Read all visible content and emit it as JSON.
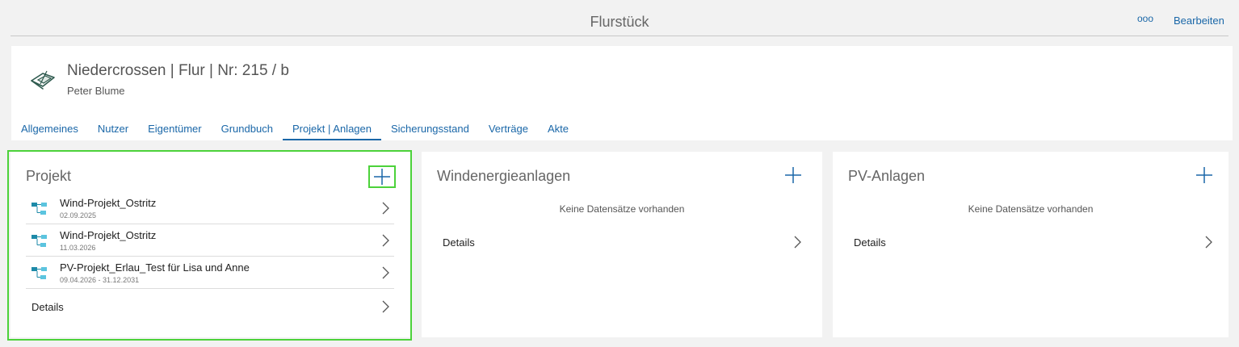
{
  "topbar": {
    "title": "Flurstück",
    "more_icon": "ooo",
    "edit_label": "Bearbeiten"
  },
  "header": {
    "title": "Niedercrossen | Flur | Nr: 215 / b",
    "subtitle": "Peter Blume",
    "icon": "parcel-icon"
  },
  "tabs": [
    {
      "label": "Allgemeines",
      "active": false
    },
    {
      "label": "Nutzer",
      "active": false
    },
    {
      "label": "Eigentümer",
      "active": false
    },
    {
      "label": "Grundbuch",
      "active": false
    },
    {
      "label": "Projekt | Anlagen",
      "active": true
    },
    {
      "label": "Sicherungsstand",
      "active": false
    },
    {
      "label": "Verträge",
      "active": false
    },
    {
      "label": "Akte",
      "active": false
    }
  ],
  "projekt": {
    "title": "Projekt",
    "items": [
      {
        "name": "Wind-Projekt_Ostritz",
        "date": "02.09.2025"
      },
      {
        "name": "Wind-Projekt_Ostritz",
        "date": "11.03.2026"
      },
      {
        "name": "PV-Projekt_Erlau_Test für Lisa und Anne",
        "date": "09.04.2026 - 31.12.2031"
      }
    ],
    "details_label": "Details"
  },
  "wind": {
    "title": "Windenergieanlagen",
    "empty": "Keine Datensätze vorhanden",
    "details_label": "Details"
  },
  "pv": {
    "title": "PV-Anlagen",
    "empty": "Keine Datensätze vorhanden",
    "details_label": "Details"
  },
  "colors": {
    "accent": "#1a67a8",
    "highlight": "#4cd23a",
    "icon_dark": "#1d8aa8",
    "icon_light": "#5bc4df"
  }
}
